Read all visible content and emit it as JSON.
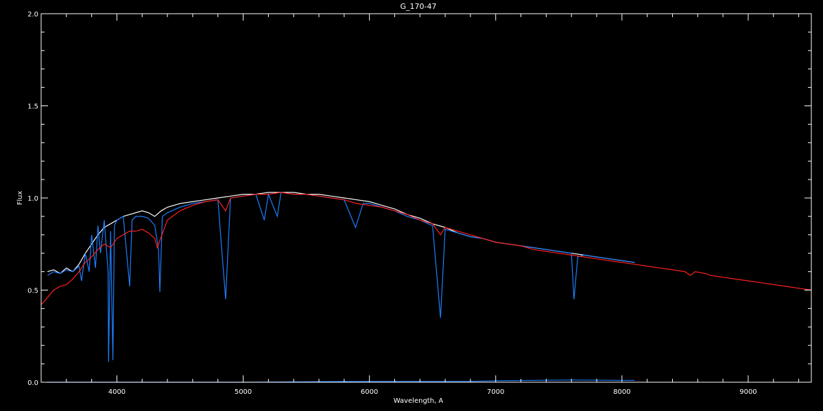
{
  "chart_data": {
    "type": "line",
    "title": "G_170-47",
    "xlabel": "Wavelength, A",
    "ylabel": "Flux",
    "xlim": [
      3400,
      9500
    ],
    "ylim": [
      0.0,
      2.0
    ],
    "xticks": [
      4000,
      5000,
      6000,
      7000,
      8000,
      9000
    ],
    "xtick_labels": [
      "4000",
      "5000",
      "6000",
      "7000",
      "8000",
      "9000"
    ],
    "yticks": [
      0.0,
      0.5,
      1.0,
      1.5,
      2.0
    ],
    "ytick_labels": [
      "0.0",
      "0.5",
      "1.0",
      "1.5",
      "2.0"
    ],
    "grid": false,
    "background": "#000000",
    "axis_color": "#ffffff",
    "series": [
      {
        "color": "#ffffff",
        "x": [
          3450,
          3500,
          3550,
          3600,
          3650,
          3700,
          3750,
          3800,
          3850,
          3900,
          3950,
          4000,
          4050,
          4100,
          4150,
          4200,
          4250,
          4300,
          4350,
          4400,
          4500,
          4600,
          4700,
          4800,
          4900,
          5000,
          5100,
          5200,
          5300,
          5400,
          5500,
          5600,
          5700,
          5800,
          5900,
          6000,
          6100,
          6200,
          6300,
          6400,
          6500,
          6600,
          6700,
          6800,
          6900,
          7000,
          7100,
          7200,
          7300,
          7400,
          7500,
          7600,
          7700,
          7800,
          7900,
          8000,
          8100
        ],
        "y": [
          0.6,
          0.61,
          0.59,
          0.62,
          0.6,
          0.64,
          0.7,
          0.75,
          0.8,
          0.84,
          0.86,
          0.88,
          0.9,
          0.91,
          0.92,
          0.93,
          0.92,
          0.9,
          0.93,
          0.95,
          0.97,
          0.98,
          0.99,
          1.0,
          1.01,
          1.02,
          1.02,
          1.03,
          1.03,
          1.03,
          1.02,
          1.02,
          1.01,
          1.0,
          0.99,
          0.98,
          0.96,
          0.94,
          0.91,
          0.89,
          0.86,
          0.84,
          0.81,
          0.79,
          0.78,
          0.76,
          0.75,
          0.74,
          0.73,
          0.72,
          0.71,
          0.7,
          0.69,
          0.68,
          0.67,
          0.66,
          0.65
        ]
      },
      {
        "color": "#1e7fff",
        "x": [
          3450,
          3500,
          3550,
          3600,
          3650,
          3700,
          3720,
          3750,
          3780,
          3800,
          3830,
          3850,
          3870,
          3900,
          3930,
          3934,
          3950,
          3968,
          3980,
          4000,
          4050,
          4101,
          4120,
          4150,
          4200,
          4250,
          4300,
          4330,
          4340,
          4360,
          4400,
          4500,
          4600,
          4700,
          4800,
          4861,
          4900,
          5000,
          5100,
          5167,
          5200,
          5270,
          5300,
          5400,
          5500,
          5600,
          5700,
          5800,
          5890,
          5950,
          6000,
          6100,
          6200,
          6300,
          6400,
          6500,
          6563,
          6600,
          6700,
          6800,
          6900,
          7000,
          7100,
          7200,
          7300,
          7400,
          7500,
          7600,
          7620,
          7650,
          7700,
          7800,
          7900,
          8000,
          8100
        ],
        "y": [
          0.58,
          0.6,
          0.59,
          0.61,
          0.6,
          0.63,
          0.55,
          0.7,
          0.6,
          0.8,
          0.62,
          0.85,
          0.7,
          0.88,
          0.6,
          0.11,
          0.82,
          0.12,
          0.85,
          0.88,
          0.9,
          0.52,
          0.88,
          0.9,
          0.9,
          0.89,
          0.85,
          0.72,
          0.49,
          0.9,
          0.92,
          0.95,
          0.97,
          0.98,
          0.99,
          0.45,
          1.0,
          1.01,
          1.02,
          0.88,
          1.02,
          0.9,
          1.03,
          1.02,
          1.02,
          1.01,
          1.0,
          0.99,
          0.84,
          0.97,
          0.97,
          0.95,
          0.93,
          0.9,
          0.88,
          0.85,
          0.35,
          0.83,
          0.81,
          0.79,
          0.78,
          0.76,
          0.75,
          0.74,
          0.73,
          0.72,
          0.71,
          0.7,
          0.45,
          0.68,
          0.69,
          0.68,
          0.67,
          0.66,
          0.65
        ]
      },
      {
        "color": "#ff2020",
        "x": [
          3400,
          3450,
          3500,
          3550,
          3600,
          3650,
          3700,
          3750,
          3800,
          3850,
          3900,
          3950,
          4000,
          4050,
          4100,
          4150,
          4200,
          4250,
          4300,
          4320,
          4340,
          4400,
          4500,
          4600,
          4700,
          4800,
          4861,
          4900,
          5000,
          5100,
          5200,
          5300,
          5400,
          5500,
          5600,
          5700,
          5800,
          5900,
          6000,
          6100,
          6200,
          6300,
          6400,
          6500,
          6563,
          6600,
          6700,
          6800,
          6900,
          7000,
          7100,
          7200,
          7300,
          7400,
          7500,
          7600,
          7700,
          7800,
          7900,
          8000,
          8100,
          8200,
          8300,
          8400,
          8500,
          8542,
          8580,
          8662,
          8700,
          8800,
          8900,
          9000,
          9100,
          9200,
          9300,
          9400,
          9500
        ],
        "y": [
          0.42,
          0.46,
          0.5,
          0.52,
          0.53,
          0.56,
          0.6,
          0.65,
          0.68,
          0.72,
          0.75,
          0.73,
          0.78,
          0.8,
          0.82,
          0.82,
          0.83,
          0.81,
          0.78,
          0.73,
          0.77,
          0.88,
          0.93,
          0.96,
          0.98,
          0.99,
          0.93,
          1.0,
          1.01,
          1.02,
          1.02,
          1.03,
          1.02,
          1.02,
          1.01,
          1.0,
          0.99,
          0.97,
          0.96,
          0.95,
          0.93,
          0.91,
          0.88,
          0.86,
          0.8,
          0.84,
          0.82,
          0.8,
          0.78,
          0.76,
          0.75,
          0.74,
          0.72,
          0.71,
          0.7,
          0.69,
          0.68,
          0.67,
          0.66,
          0.65,
          0.64,
          0.63,
          0.62,
          0.61,
          0.6,
          0.58,
          0.6,
          0.59,
          0.58,
          0.57,
          0.56,
          0.55,
          0.54,
          0.53,
          0.52,
          0.51,
          0.5
        ]
      },
      {
        "color": "#1e7fff",
        "x": [
          3450,
          4000,
          5000,
          6000,
          6800,
          7000,
          7600,
          8000,
          8100
        ],
        "y": [
          0.0,
          0.0,
          0.0,
          0.005,
          0.005,
          0.008,
          0.012,
          0.01,
          0.01
        ]
      }
    ]
  }
}
